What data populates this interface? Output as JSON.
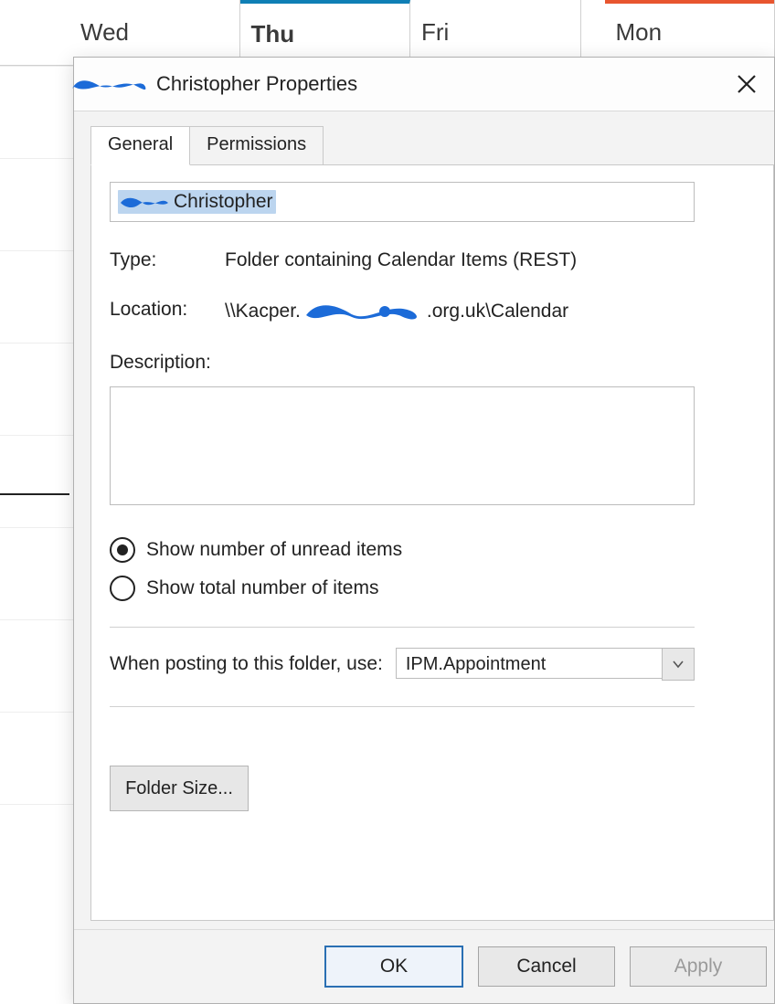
{
  "calendar": {
    "days": [
      {
        "label": "Wed",
        "selected": false
      },
      {
        "label": "Thu",
        "selected": true
      },
      {
        "label": "Fri",
        "selected": false
      },
      {
        "label": "Mon",
        "selected": false,
        "accent": true
      }
    ]
  },
  "dialog": {
    "title": "Christopher Properties",
    "tabs": [
      {
        "id": "general",
        "label": "General",
        "active": true
      },
      {
        "id": "permissions",
        "label": "Permissions",
        "active": false
      }
    ],
    "fields": {
      "name_value": "Christopher",
      "type_label": "Type:",
      "type_value": "Folder containing Calendar Items (REST)",
      "location_label": "Location:",
      "location_prefix": "\\\\Kacper.",
      "location_suffix": ".org.uk\\Calendar",
      "description_label": "Description:",
      "description_value": ""
    },
    "radios": {
      "unread_label": "Show number of unread items",
      "total_label": "Show total number of items",
      "selected": "unread"
    },
    "posting": {
      "label": "When posting to this folder, use:",
      "value": "IPM.Appointment"
    },
    "folder_size_label": "Folder Size...",
    "buttons": {
      "ok": "OK",
      "cancel": "Cancel",
      "apply": "Apply"
    }
  }
}
